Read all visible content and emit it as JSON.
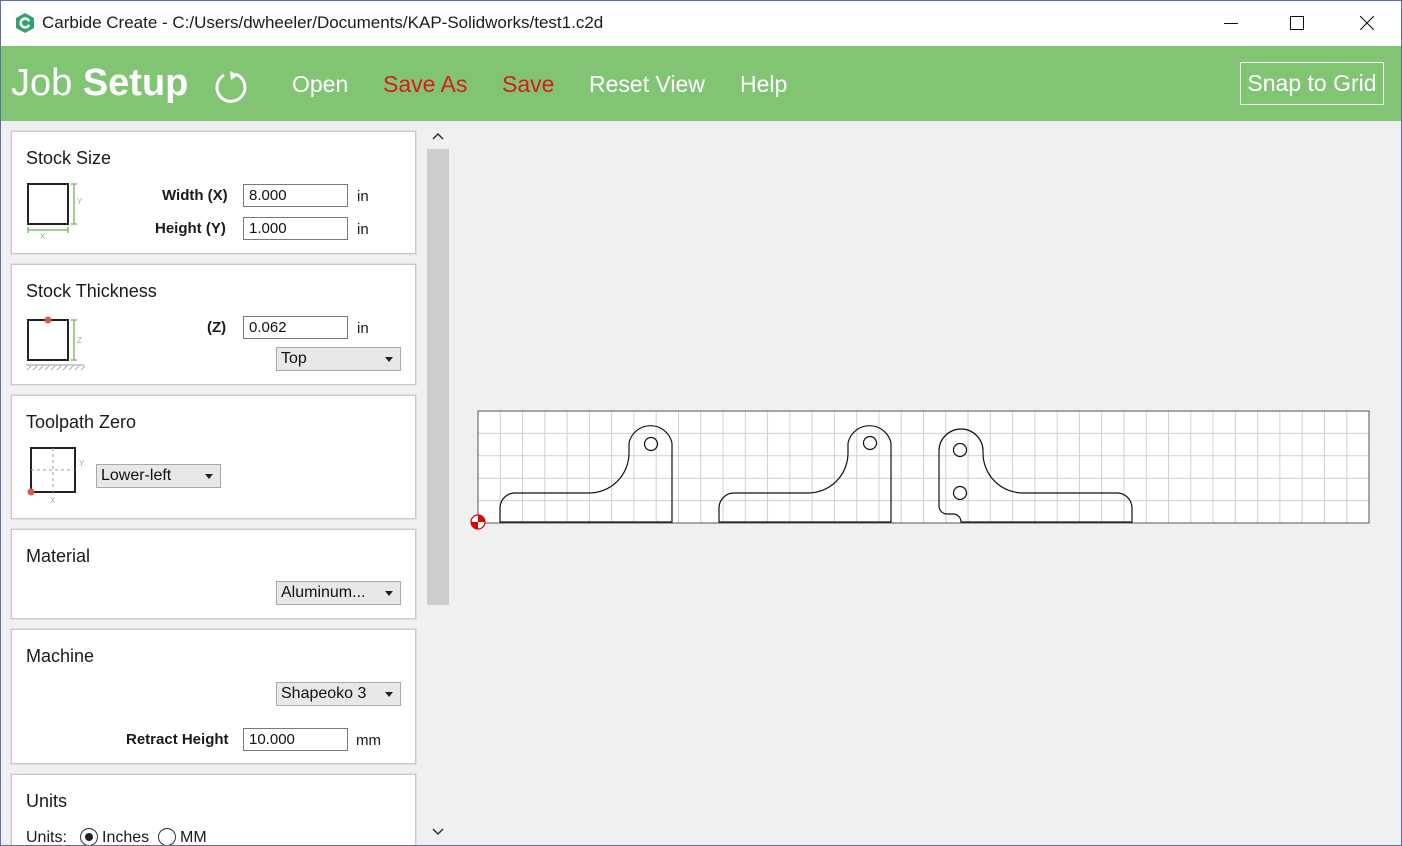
{
  "window": {
    "title": "Carbide Create - C:/Users/dwheeler/Documents/KAP-Solidworks/test1.c2d",
    "icons": {
      "app": "carbide-create-logo-icon",
      "minimize": "minimize-icon",
      "maximize": "maximize-icon",
      "close": "close-icon"
    }
  },
  "toolbar": {
    "title_light": "Job ",
    "title_bold": "Setup",
    "refresh_icon": "refresh-icon",
    "open_label": "Open",
    "save_as_label": "Save As",
    "save_label": "Save",
    "reset_view_label": "Reset View",
    "help_label": "Help",
    "snap_to_grid_label": "Snap to Grid",
    "colors": {
      "background": "#81c574",
      "link": "#ffffff",
      "unsaved_link": "#d51d1d"
    }
  },
  "stock_size": {
    "title": "Stock Size",
    "width_label": "Width (X)",
    "width_value": "8.000",
    "width_unit": "in",
    "height_label": "Height (Y)",
    "height_value": "1.000",
    "height_unit": "in",
    "diagram_x": "X",
    "diagram_y": "Y"
  },
  "stock_thickness": {
    "title": "Stock Thickness",
    "z_label": "(Z)",
    "z_value": "0.062",
    "z_unit": "in",
    "zero_face": "Top",
    "diagram_z": "Z"
  },
  "toolpath_zero": {
    "title": "Toolpath Zero",
    "position": "Lower-left",
    "diagram_x": "X",
    "diagram_y": "Y"
  },
  "material": {
    "title": "Material",
    "selected": "Aluminum..."
  },
  "machine": {
    "title": "Machine",
    "selected": "Shapeoko 3",
    "retract_label": "Retract Height",
    "retract_value": "10.000",
    "retract_unit": "mm"
  },
  "units": {
    "title": "Units",
    "label": "Units:",
    "options": [
      "Inches",
      "MM"
    ],
    "selected": "Inches"
  },
  "canvas": {
    "stock": {
      "width_in": 8.0,
      "height_in": 1.0
    },
    "grid_spacing_in": 0.2,
    "origin_marker": "origin-marker-icon"
  }
}
